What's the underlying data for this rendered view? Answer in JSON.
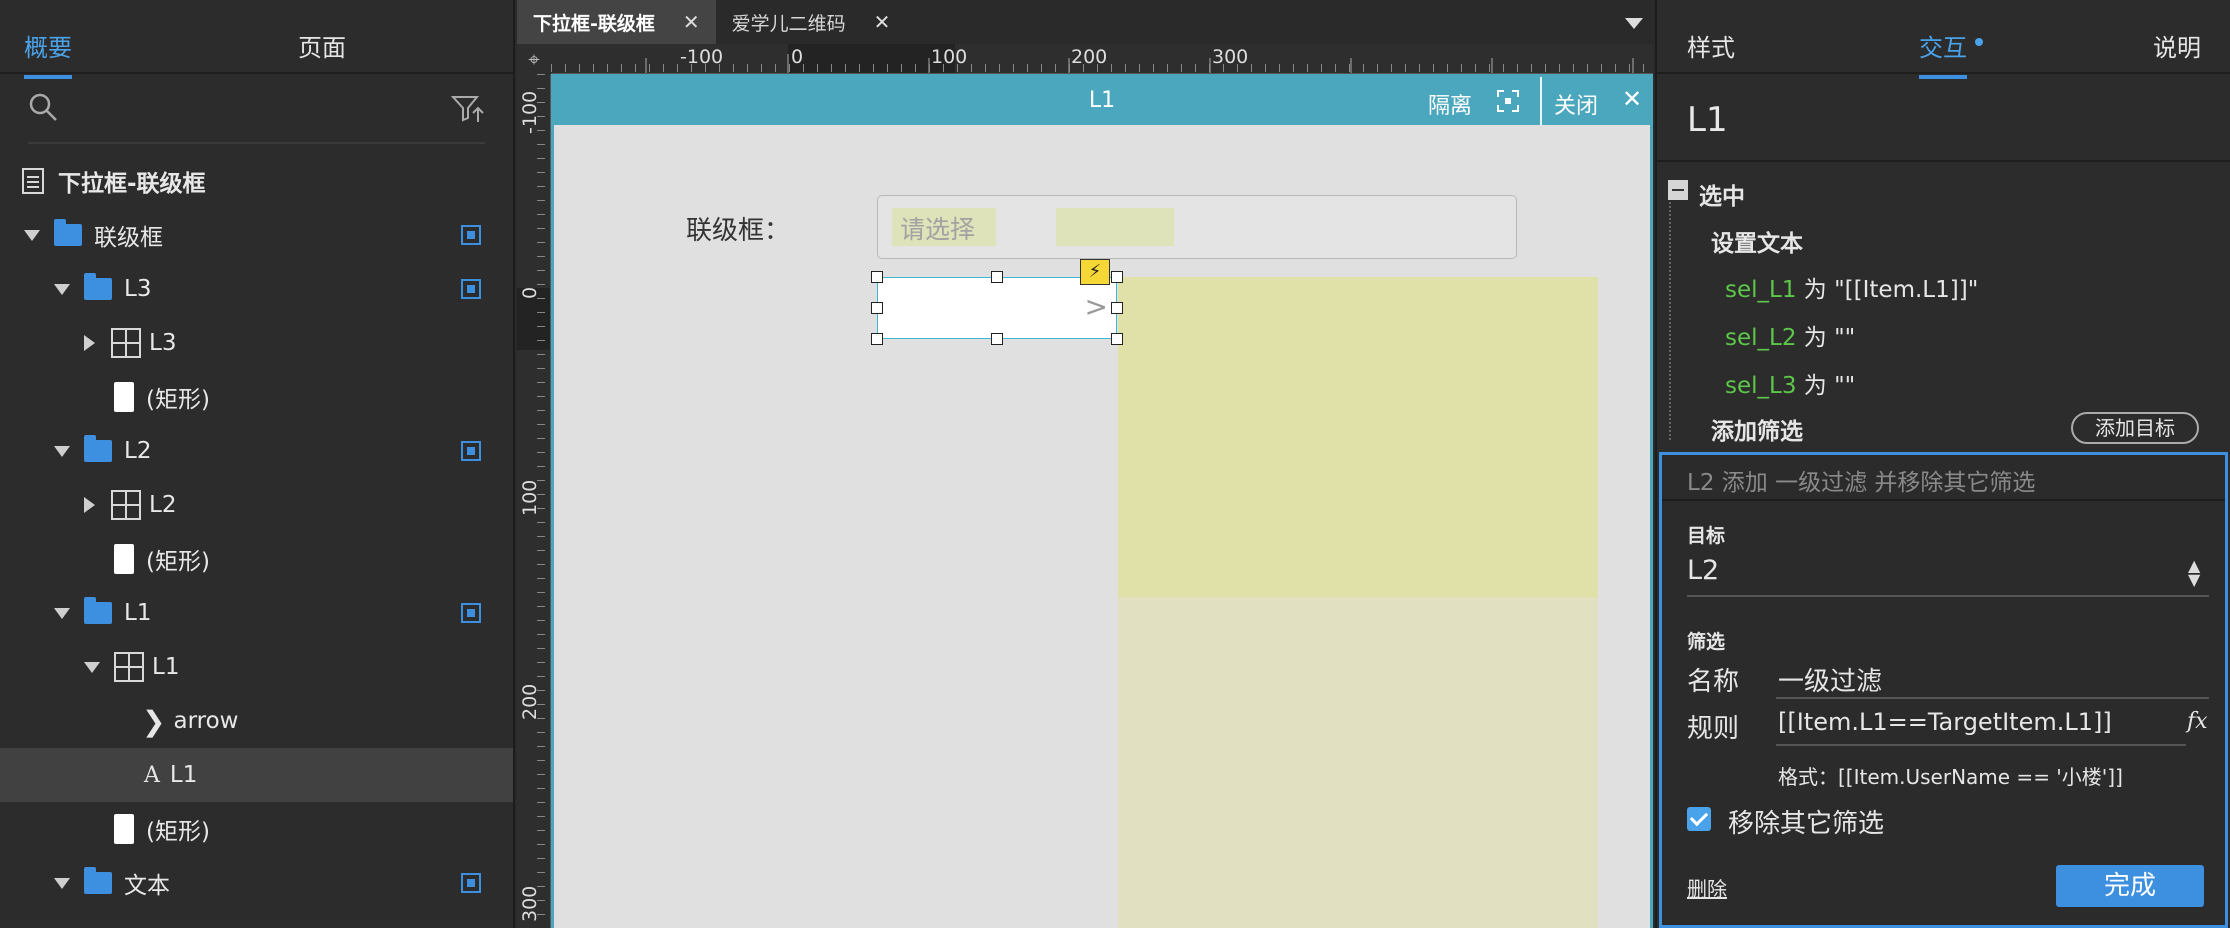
{
  "left_panel": {
    "tabs": [
      "概要",
      "页面"
    ],
    "tree": [
      {
        "label": "下拉框-联级框",
        "type": "page"
      },
      {
        "label": "联级框",
        "type": "folder"
      },
      {
        "label": "L3",
        "type": "folder"
      },
      {
        "label": "L3",
        "type": "repeater"
      },
      {
        "label": "(矩形)",
        "type": "rect"
      },
      {
        "label": "L2",
        "type": "folder"
      },
      {
        "label": "L2",
        "type": "repeater"
      },
      {
        "label": "(矩形)",
        "type": "rect"
      },
      {
        "label": "L1",
        "type": "folder"
      },
      {
        "label": "L1",
        "type": "repeater"
      },
      {
        "label": "arrow",
        "type": "chevron"
      },
      {
        "label": "L1",
        "type": "text",
        "selected": true
      },
      {
        "label": "(矩形)",
        "type": "rect"
      },
      {
        "label": "文本",
        "type": "folder"
      }
    ]
  },
  "center": {
    "doc_tabs": [
      {
        "label": "下拉框-联级框",
        "active": true
      },
      {
        "label": "爱学儿二维码",
        "active": false
      }
    ],
    "ruler_h": [
      "-100",
      "0",
      "100",
      "200",
      "300"
    ],
    "ruler_v": [
      "-100",
      "0",
      "100",
      "200",
      "300"
    ],
    "isolate_title": "L1",
    "isolate_btn": "隔离",
    "close_btn": "关闭",
    "canvas": {
      "label": "联级框：",
      "placeholder": "请选择",
      "arrow": ">"
    }
  },
  "right_panel": {
    "tabs": [
      "样式",
      "交互",
      "说明"
    ],
    "name": "L1",
    "case_title": "选中",
    "action1": "设置文本",
    "lines": [
      {
        "target": "sel_L1",
        "text": " 为 \"[[Item.L1]]\""
      },
      {
        "target": "sel_L2",
        "text": " 为 \"\""
      },
      {
        "target": "sel_L3",
        "text": " 为 \"\""
      }
    ],
    "action2": "添加筛选",
    "add_target_btn": "添加目标",
    "editor": {
      "header": "L2 添加 一级过滤 并移除其它筛选",
      "target_label": "目标",
      "target_value": "L2",
      "filter_label": "筛选",
      "name_label": "名称",
      "name_value": "一级过滤",
      "rule_label": "规则",
      "rule_value": "[[Item.L1==TargetItem.L1]]",
      "fx": "fx",
      "format_hint": "格式：[[Item.UserName == '小楼']]",
      "checkbox_label": "移除其它筛选",
      "delete_link": "删除",
      "done_btn": "完成"
    }
  }
}
